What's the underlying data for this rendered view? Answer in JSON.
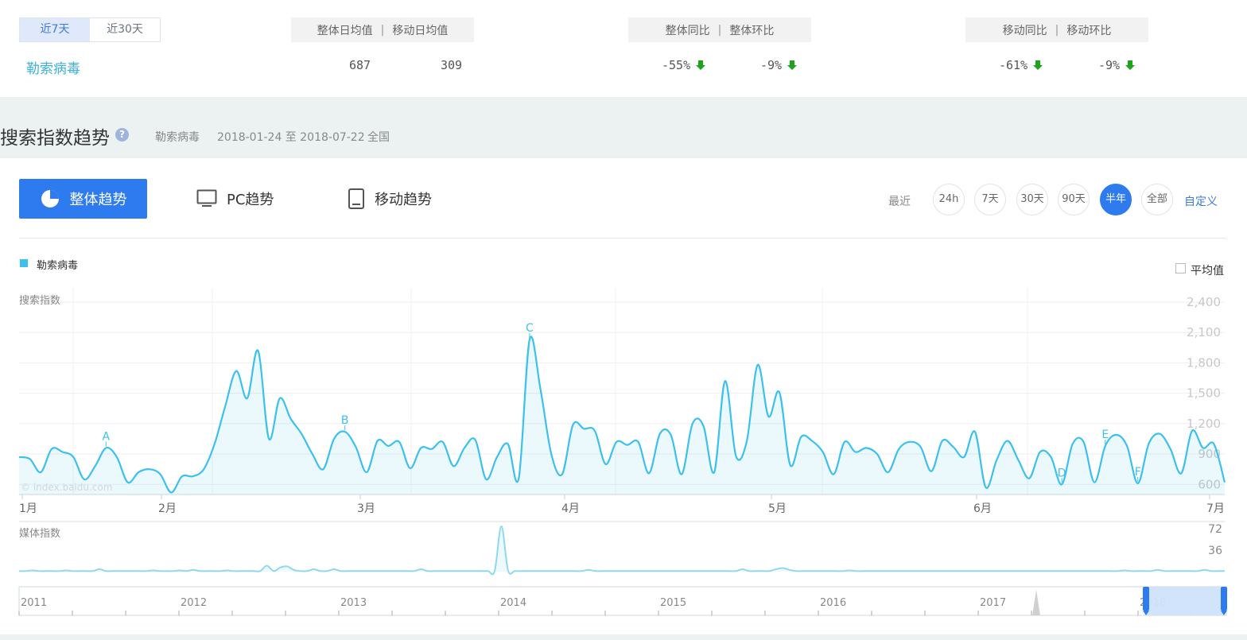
{
  "range_tabs": [
    {
      "label": "近7天",
      "active": true
    },
    {
      "label": "近30天",
      "active": false
    }
  ],
  "keyword": "勒索病毒",
  "stats": {
    "avg_header": {
      "overall": "整体日均值",
      "mobile": "移动日均值"
    },
    "avg_values": {
      "overall": "687",
      "mobile": "309"
    },
    "overall_header": {
      "yoy": "整体同比",
      "mom": "整体环比"
    },
    "overall_values": {
      "yoy": "-55%",
      "mom": "-9%"
    },
    "mobile_header": {
      "yoy": "移动同比",
      "mom": "移动环比"
    },
    "mobile_values": {
      "yoy": "-61%",
      "mom": "-9%"
    }
  },
  "section": {
    "title": "搜索指数趋势",
    "help_glyph": "?",
    "keyword": "勒索病毒",
    "date_range": "2018-01-24 至 2018-07-22",
    "region": "全国"
  },
  "view_tabs": {
    "overall": "整体趋势",
    "pc": "PC趋势",
    "mobile": "移动趋势"
  },
  "periods": {
    "label": "最近",
    "options": [
      {
        "label": "24h",
        "active": false
      },
      {
        "label": "7天",
        "active": false
      },
      {
        "label": "30天",
        "active": false
      },
      {
        "label": "90天",
        "active": false
      },
      {
        "label": "半年",
        "active": true
      },
      {
        "label": "全部",
        "active": false
      }
    ],
    "custom": "自定义"
  },
  "legend": {
    "name": "勒索病毒",
    "color": "#3cc0ee"
  },
  "average_toggle": {
    "label": "平均值",
    "checked": false
  },
  "watermark": "© index.baidu.com",
  "colors": {
    "accent": "#2e7bef",
    "series": "#3cc0ee",
    "down": "#1fa31f",
    "link": "#3cb1dd"
  },
  "chart_data": [
    {
      "type": "line",
      "ylabel": "搜索指数",
      "ylim": [
        500,
        2400
      ],
      "yticks": [
        600,
        900,
        1200,
        1500,
        1800,
        2100,
        2400
      ],
      "ytick_labels": [
        "600",
        "900",
        "1,200",
        "1,500",
        "1,800",
        "2,100",
        "2,400"
      ],
      "x_month_labels": [
        "1月",
        "2月",
        "3月",
        "4月",
        "5月",
        "6月",
        "7月"
      ],
      "annotations": [
        {
          "label": "A",
          "index": 8
        },
        {
          "label": "B",
          "index": 30
        },
        {
          "label": "C",
          "index": 47
        },
        {
          "label": "D",
          "index": 96
        },
        {
          "label": "E",
          "index": 100
        },
        {
          "label": "F",
          "index": 103
        }
      ],
      "series": [
        {
          "name": "勒索病毒",
          "values": [
            870,
            850,
            720,
            950,
            920,
            870,
            650,
            780,
            960,
            870,
            620,
            720,
            750,
            700,
            520,
            680,
            680,
            750,
            1000,
            1380,
            1720,
            1450,
            1920,
            1050,
            1450,
            1250,
            1100,
            900,
            750,
            1050,
            1120,
            970,
            720,
            1030,
            980,
            1020,
            760,
            960,
            950,
            1020,
            780,
            960,
            1040,
            650,
            870,
            1000,
            660,
            2030,
            1540,
            900,
            700,
            1190,
            1150,
            1130,
            800,
            1020,
            990,
            1020,
            710,
            1100,
            1090,
            700,
            1200,
            1180,
            720,
            1620,
            880,
            1030,
            1780,
            1270,
            1510,
            790,
            1070,
            1030,
            920,
            700,
            1020,
            920,
            960,
            900,
            720,
            950,
            1020,
            970,
            730,
            1030,
            970,
            870,
            1120,
            570,
            840,
            1030,
            840,
            660,
            920,
            870,
            600,
            1000,
            1020,
            620,
            980,
            1090,
            980,
            610,
            1000,
            1100,
            950,
            710,
            1130,
            960,
            1000,
            620
          ]
        }
      ]
    },
    {
      "type": "line",
      "ylabel": "媒体指数",
      "ylim": [
        0,
        80
      ],
      "yticks": [
        36,
        72
      ],
      "ytick_labels": [
        "36",
        "72"
      ],
      "series": [
        {
          "values": [
            1,
            1,
            2,
            1,
            1,
            1,
            1,
            2,
            1,
            1,
            1,
            1,
            4,
            1,
            1,
            1,
            1,
            1,
            1,
            1,
            2,
            1,
            1,
            1,
            2,
            1,
            3,
            1,
            1,
            1,
            1,
            2,
            1,
            1,
            1,
            1,
            1,
            10,
            1,
            7,
            9,
            3,
            1,
            1,
            4,
            1,
            1,
            4,
            1,
            1,
            1,
            1,
            1,
            1,
            1,
            1,
            1,
            1,
            1,
            1,
            4,
            1,
            1,
            1,
            1,
            1,
            1,
            1,
            1,
            1,
            1,
            1,
            76,
            2,
            1,
            1,
            1,
            1,
            1,
            1,
            1,
            1,
            1,
            1,
            1,
            3,
            1,
            1,
            1,
            1,
            1,
            1,
            1,
            1,
            1,
            1,
            1,
            1,
            1,
            1,
            1,
            1,
            1,
            1,
            1,
            1,
            1,
            1,
            4,
            1,
            1,
            1,
            1,
            4,
            6,
            3,
            1,
            1,
            1,
            1,
            1,
            1,
            1,
            1,
            2,
            1,
            1,
            1,
            1,
            1,
            1,
            1,
            1,
            1,
            1,
            1,
            1,
            1,
            1,
            1,
            1,
            1,
            1,
            1,
            1,
            1,
            1,
            1,
            1,
            1,
            1,
            1,
            1,
            1,
            1,
            1,
            1,
            1,
            1,
            1,
            1,
            1,
            1,
            1,
            1,
            2,
            1,
            1,
            1,
            1,
            3,
            1,
            1,
            1,
            1,
            1,
            1,
            3,
            1,
            1,
            1
          ]
        }
      ]
    },
    {
      "type": "area",
      "x_year_labels": [
        "2011",
        "2012",
        "2013",
        "2014",
        "2015",
        "2016",
        "2017",
        "2018"
      ],
      "selection": [
        "2018-01",
        "2018-07"
      ]
    }
  ]
}
